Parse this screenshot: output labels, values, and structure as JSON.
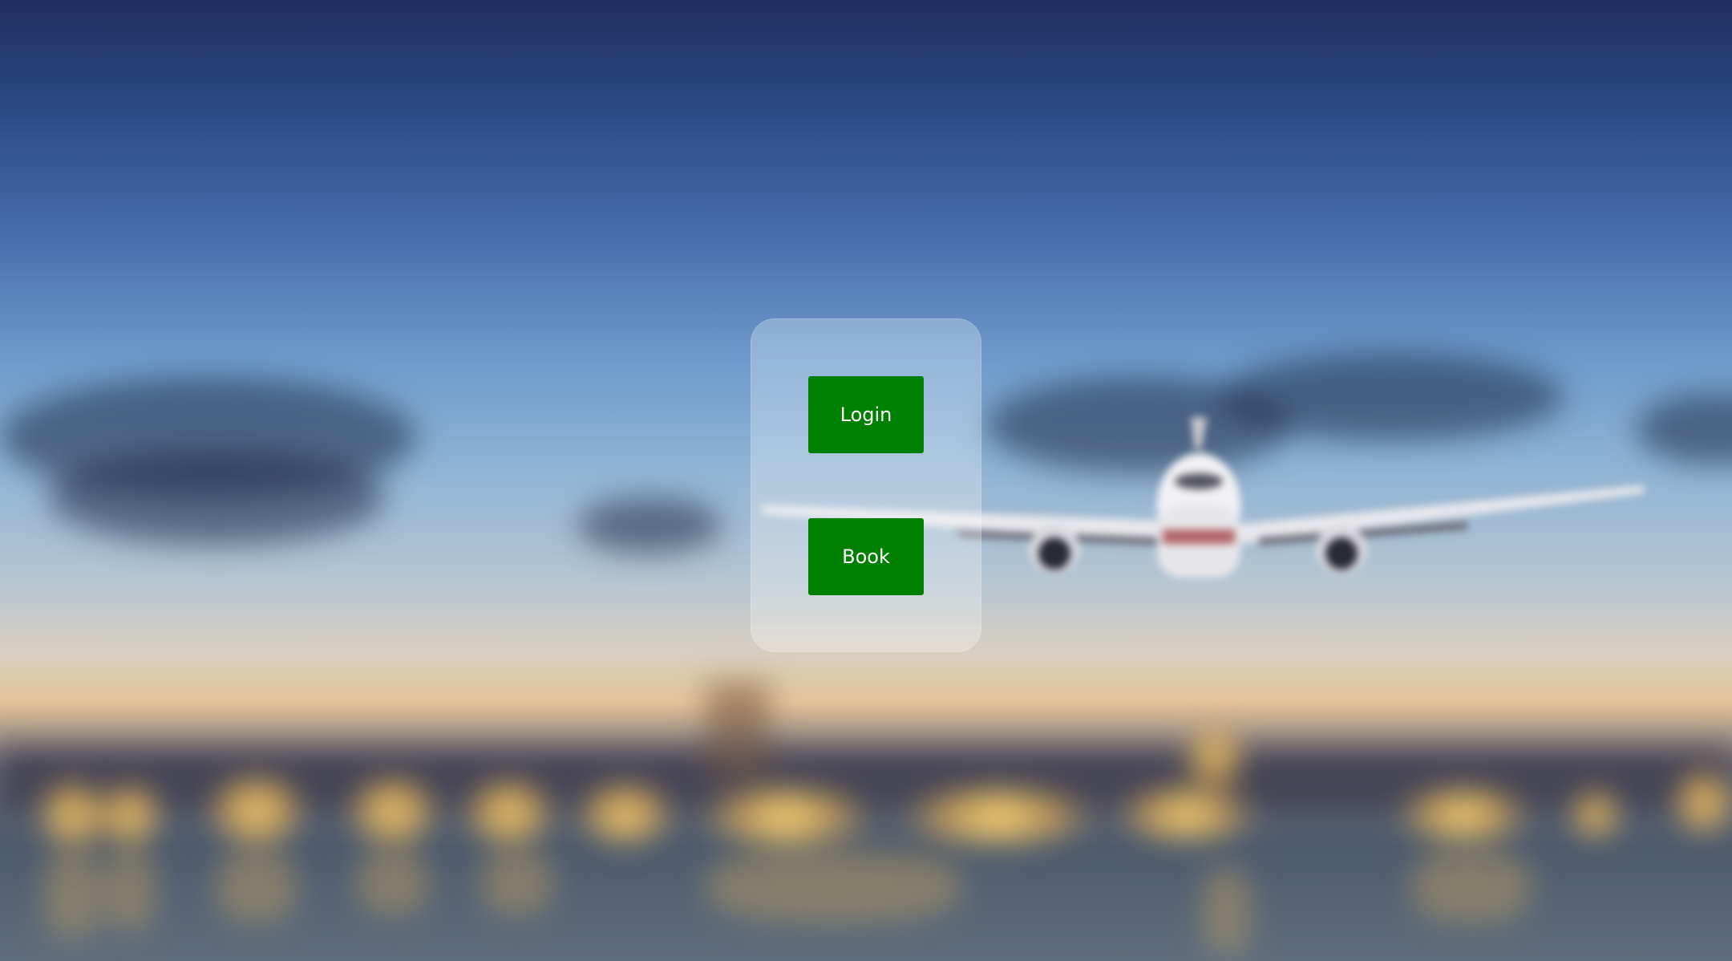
{
  "buttons": {
    "login_label": "Login",
    "book_label": "Book"
  },
  "colors": {
    "button_background": "#008000",
    "button_text": "#ffffff",
    "panel_background": "rgba(255,255,255,0.28)"
  },
  "background": {
    "subject": "airplane-landing-at-dusk"
  }
}
